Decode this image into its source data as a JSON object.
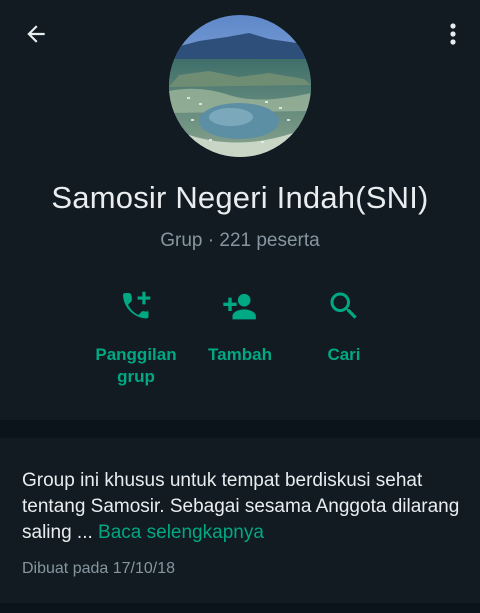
{
  "header": {
    "back_icon": "arrow-left-icon",
    "menu_icon": "more-vertical-icon",
    "group_name": "Samosir Negeri Indah(SNI)",
    "group_meta": "Grup · 221 peserta"
  },
  "actions": [
    {
      "icon": "add-call-icon",
      "line1": "Panggilan",
      "line2": "grup"
    },
    {
      "icon": "add-person-icon",
      "line1": "Tambah",
      "line2": ""
    },
    {
      "icon": "search-icon",
      "line1": "Cari",
      "line2": ""
    }
  ],
  "description": {
    "text": "Group ini khusus untuk tempat berdiskusi sehat tentang Samosir. Sebagai sesama Anggota dilarang saling ... ",
    "read_more": "Baca selengkapnya",
    "created": "Dibuat pada 17/10/18"
  },
  "colors": {
    "background": "#0b141a",
    "panel": "#111b21",
    "accent": "#00a884",
    "text_primary": "#e9edef",
    "text_secondary": "#8696a0"
  }
}
